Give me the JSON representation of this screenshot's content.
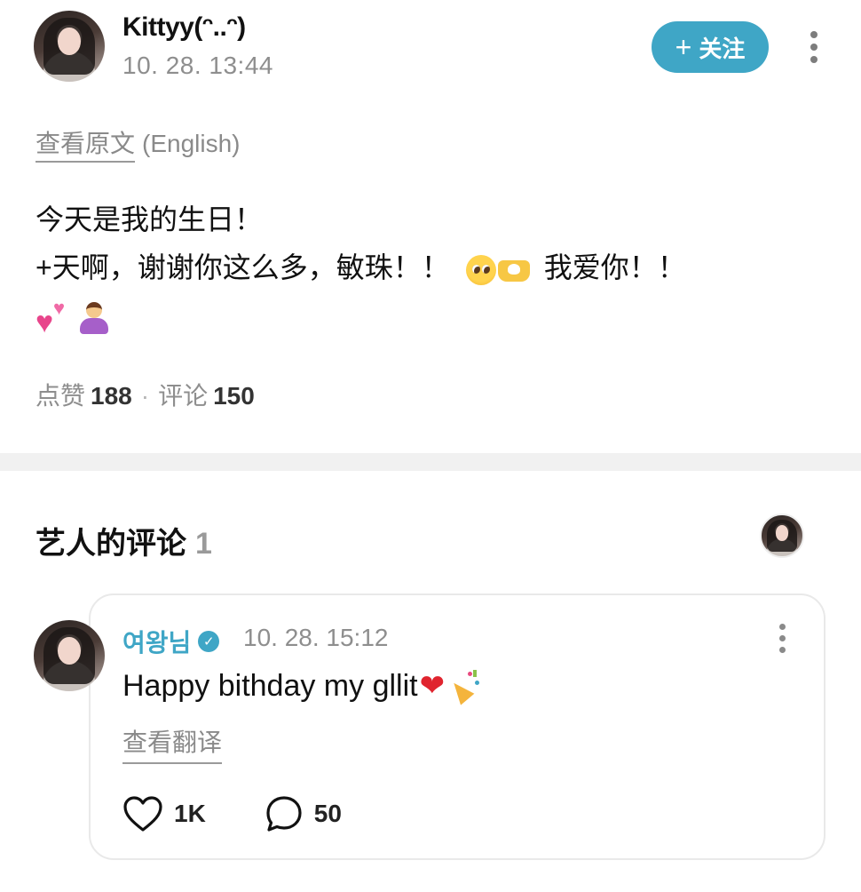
{
  "post": {
    "username": "Kittyy(ᵔ..ᵔ)",
    "time": "10. 28. 13:44",
    "follow_label": "关注",
    "view_original_label": "查看原文",
    "view_original_lang": "(English)",
    "body_line1": "今天是我的生日！",
    "body_line2": "+天啊，谢谢你这么多，敏珠！！",
    "body_line2_tail": "我爱你！！",
    "emojis": [
      "pleading-face-icon",
      "heart-hands-icon",
      "two-hearts-icon",
      "person-bowing-icon"
    ]
  },
  "stats": {
    "likes_label": "点赞",
    "likes": "188",
    "separator": "·",
    "comments_label": "评论",
    "comments": "150"
  },
  "artist_comments": {
    "title": "艺人的评论",
    "count": "1"
  },
  "comment": {
    "author": "여왕님",
    "time": "10. 28. 15:12",
    "text": "Happy bithday my gllit",
    "view_translation_label": "查看翻译",
    "likes": "1K",
    "replies": "50"
  },
  "colors": {
    "accent": "#3fa6c6",
    "muted_text": "#8e8e8e",
    "divider": "#f1f1f1"
  }
}
